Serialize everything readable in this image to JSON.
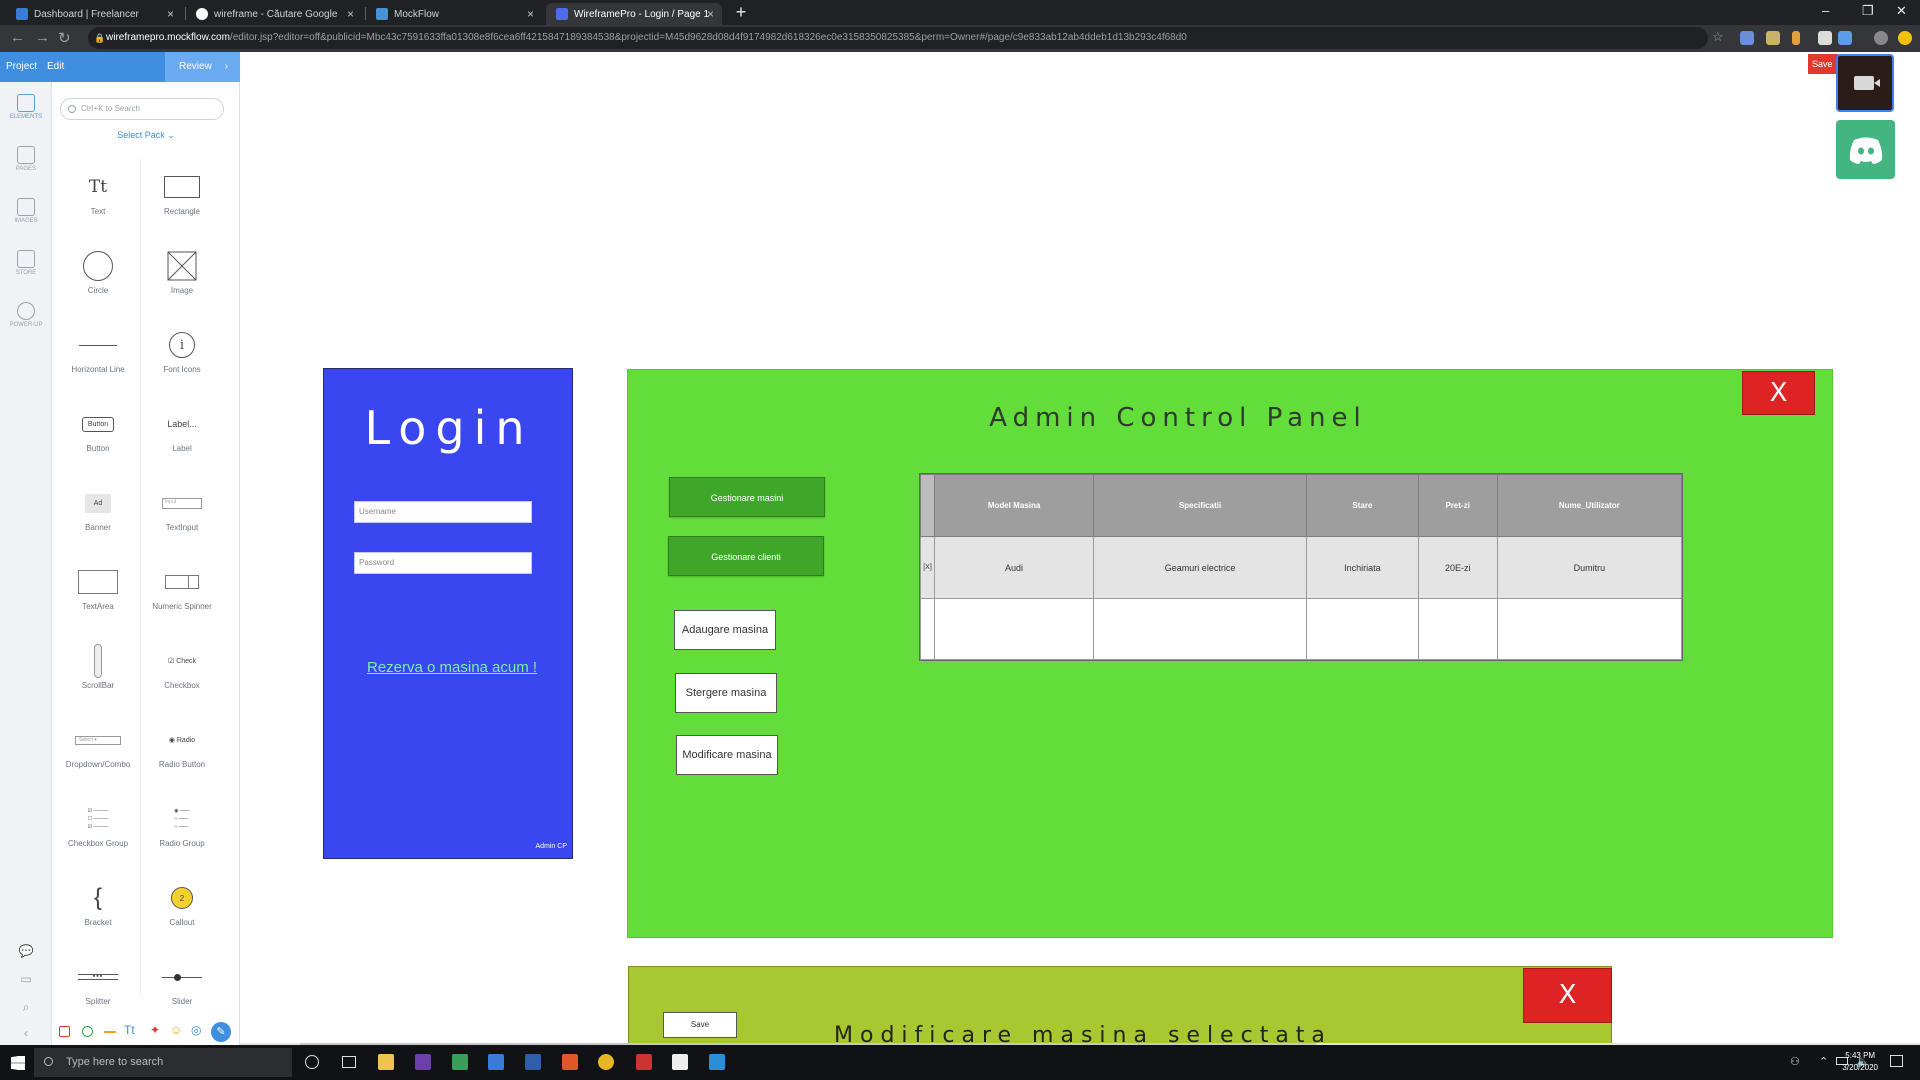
{
  "browser": {
    "tabs": [
      {
        "label": "Dashboard | Freelancer",
        "color": "#3a7bd5"
      },
      {
        "label": "wireframe - Căutare Google",
        "color": "#ffffff"
      },
      {
        "label": "MockFlow",
        "color": "#4a90d9"
      },
      {
        "label": "WireframePro - Login / Page 1",
        "color": "#4f6bed"
      }
    ],
    "new_tab": "+",
    "url_domain": "wireframepro.mockflow.com",
    "url_path": "/editor.jsp?editor=off&publicid=Mbc43c7591633ffa01308e8f6cea6ff4215847189384538&projectid=M45d9628d08d4f9174982d618326ec0e3158350825385&perm=Owner#/page/c9e833ab12ab4ddeb1d13b293c4f68d0"
  },
  "app": {
    "menu": [
      "Project",
      "Edit"
    ],
    "review": "Review",
    "save": "Save",
    "rail": [
      "ELEMENTS",
      "PAGES",
      "IMAGES",
      "STORE",
      "POWER-UP"
    ],
    "search_placeholder": "Ctrl+K to Search",
    "select_pack": "Select Pack",
    "palette": [
      {
        "label": "Text",
        "icon": "text-icon"
      },
      {
        "label": "Rectangle",
        "icon": "rectangle-icon"
      },
      {
        "label": "Circle",
        "icon": "circle-icon"
      },
      {
        "label": "Image",
        "icon": "image-icon"
      },
      {
        "label": "Horizontal Line",
        "icon": "line-icon"
      },
      {
        "label": "Font Icons",
        "icon": "info-icon"
      },
      {
        "label": "Button",
        "icon": "button-icon"
      },
      {
        "label": "Label",
        "icon": "label-icon"
      },
      {
        "label": "Banner",
        "icon": "banner-icon"
      },
      {
        "label": "TextInput",
        "icon": "textinput-icon"
      },
      {
        "label": "TextArea",
        "icon": "textarea-icon"
      },
      {
        "label": "Numeric Spinner",
        "icon": "spinner-icon"
      },
      {
        "label": "ScrollBar",
        "icon": "scrollbar-icon"
      },
      {
        "label": "Checkbox",
        "icon": "checkbox-icon"
      },
      {
        "label": "Dropdown/Combo",
        "icon": "dropdown-icon"
      },
      {
        "label": "Radio Button",
        "icon": "radio-icon"
      },
      {
        "label": "Checkbox Group",
        "icon": "checkbox-group-icon"
      },
      {
        "label": "Radio Group",
        "icon": "radio-group-icon"
      },
      {
        "label": "Bracket",
        "icon": "bracket-icon"
      },
      {
        "label": "Callout",
        "icon": "callout-icon"
      },
      {
        "label": "Splitter",
        "icon": "splitter-icon"
      },
      {
        "label": "Slider",
        "icon": "slider-icon"
      }
    ],
    "palette_previews": {
      "text": "Tt",
      "button": "Button",
      "label": "Label...",
      "banner": "Ad",
      "textinput": "Input",
      "checkbox": "Check",
      "dropdown": "Select",
      "radio": "Radio",
      "bracket": "{",
      "callout": "2"
    }
  },
  "login": {
    "title": "Login",
    "username_placeholder": "Username",
    "password_placeholder": "Password",
    "link": "Rezerva o masina acum !",
    "admin": "Admin CP"
  },
  "acp": {
    "title": "Admin Control Panel",
    "close": "X",
    "green_buttons": [
      "Gestionare masini",
      "Gestionare clienti"
    ],
    "white_buttons": [
      "Adaugare masina",
      "Stergere masina",
      "Modificare masina"
    ],
    "table": {
      "headers": [
        "Model Masina",
        "Specificatii",
        "Stare",
        "Pret-zi",
        "Nume_Utilizator"
      ],
      "rows": [
        [
          "Audi",
          "Geamuri electrice",
          "Inchiriata",
          "20E-zi",
          "Dumitru"
        ],
        [
          "",
          "",
          "",
          "",
          ""
        ]
      ],
      "row_marker": "[X]"
    }
  },
  "modify": {
    "title": "Modificare masina selectata",
    "close": "X",
    "save": "Save"
  },
  "taskbar": {
    "search": "Type here to search",
    "time": "5:43 PM",
    "date": "3/20/2020"
  }
}
